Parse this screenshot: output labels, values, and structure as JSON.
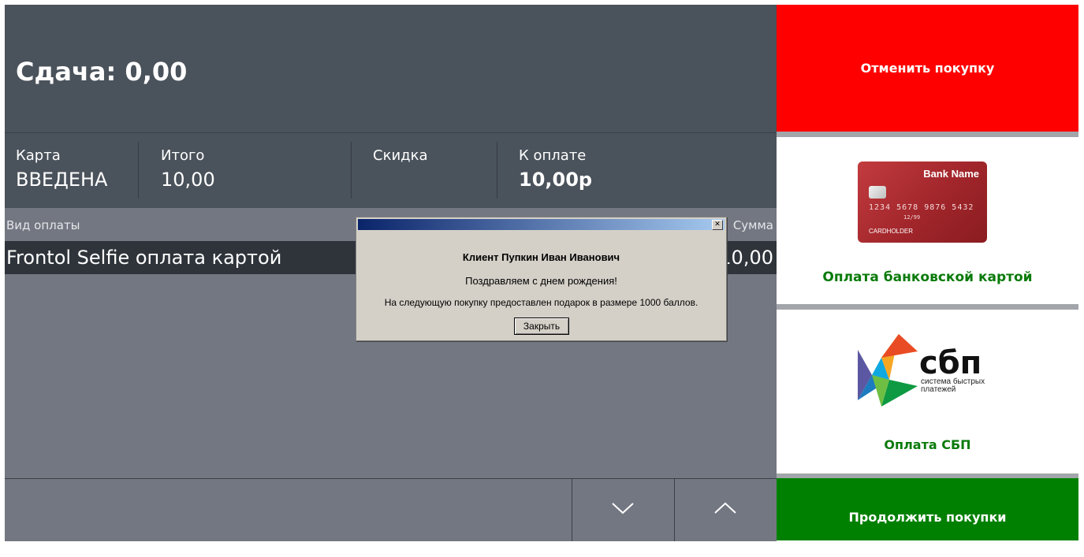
{
  "header": {
    "change_text": "Сдача: 0,00"
  },
  "summary": {
    "card": {
      "label": "Карта",
      "value": "ВВЕДЕНА"
    },
    "total": {
      "label": "Итого",
      "value": "10,00"
    },
    "discount": {
      "label": "Скидка",
      "value": ""
    },
    "to_pay": {
      "label": "К оплате",
      "value": "10,00р"
    }
  },
  "payments": {
    "columns": {
      "type": "Вид оплаты",
      "amount": "Сумма"
    },
    "rows": [
      {
        "type": "Frontol Selfie оплата картой",
        "amount": "10,00"
      }
    ]
  },
  "nav": {
    "down_icon": "chevron-down-icon",
    "up_icon": "chevron-up-icon"
  },
  "actions": {
    "cancel": "Отменить покупку",
    "card_pay": "Оплата банковской картой",
    "sbp_pay": "Оплата СБП",
    "continue": "Продолжить покупки"
  },
  "card_image": {
    "bank": "Bank Name",
    "number": "1234 5678 9876 5432",
    "prefix": "1234",
    "expiry": "12/99",
    "holder": "CARDHOLDER"
  },
  "sbp_logo": {
    "word": "сбп",
    "subtitle": "система быстрых платежей"
  },
  "dialog": {
    "close_symbol": "✕",
    "heading": "Клиент Пупкин Иван Иванович",
    "line1": "Поздравляем с днем рождения!",
    "line2": "На следующую покупку предоставлен подарок в размере 1000 баллов.",
    "button": "Закрыть"
  },
  "colors": {
    "cancel": "#ff0000",
    "continue": "#008000",
    "panel": "#4a525b",
    "label_green": "#0a7a0a"
  }
}
